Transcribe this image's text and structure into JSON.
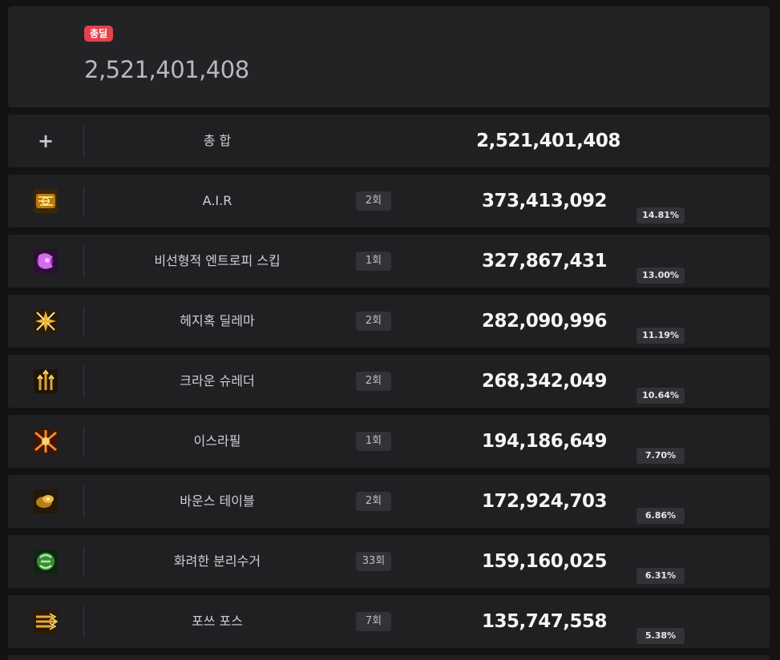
{
  "summary": {
    "badge": "총딜",
    "total": "2,521,401,408"
  },
  "total_row": {
    "expand_symbol": "+",
    "label": "총 합",
    "value": "2,521,401,408"
  },
  "skills": [
    {
      "name": "A.I.R",
      "count": "2회",
      "damage": "373,413,092",
      "percent": "14.81%",
      "icon": "circuit-skill-icon"
    },
    {
      "name": "비선형적 엔트로피 스킵",
      "count": "1회",
      "damage": "327,867,431",
      "percent": "13.00%",
      "icon": "entropy-skill-icon"
    },
    {
      "name": "헤지혹 딜레마",
      "count": "2회",
      "damage": "282,090,996",
      "percent": "11.19%",
      "icon": "hedgehog-skill-icon"
    },
    {
      "name": "크라운 슈레더",
      "count": "2회",
      "damage": "268,342,049",
      "percent": "10.64%",
      "icon": "crown-shredder-skill-icon"
    },
    {
      "name": "이스라필",
      "count": "1회",
      "damage": "194,186,649",
      "percent": "7.70%",
      "icon": "israfil-skill-icon"
    },
    {
      "name": "바운스 테이블",
      "count": "2회",
      "damage": "172,924,703",
      "percent": "6.86%",
      "icon": "bounce-table-skill-icon"
    },
    {
      "name": "화려한 분리수거",
      "count": "33회",
      "damage": "159,160,025",
      "percent": "6.31%",
      "icon": "recycle-skill-icon"
    },
    {
      "name": "포쓰 포스",
      "count": "7회",
      "damage": "135,747,558",
      "percent": "5.38%",
      "icon": "force-skill-icon"
    }
  ],
  "colors": {
    "badge": "#e2434e",
    "background": "#131314",
    "row": "#202023",
    "pill": "#333337"
  }
}
